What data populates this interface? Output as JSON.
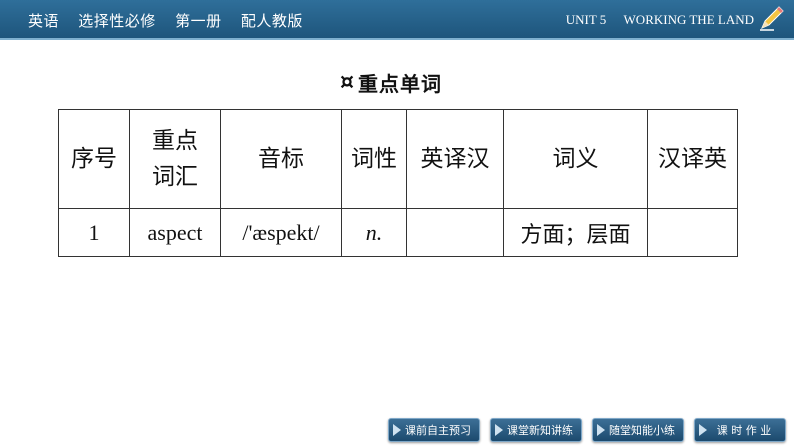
{
  "header": {
    "left": [
      "英语",
      "选择性必修",
      "第一册",
      "配人教版"
    ],
    "unit": "UNIT 5",
    "unit_title": "WORKING THE LAND"
  },
  "section": {
    "symbol": "¤",
    "title": "重点单词"
  },
  "table": {
    "headers": [
      "序号",
      "重点\n词汇",
      "音标",
      "词性",
      "英译汉",
      "词义",
      "汉译英"
    ],
    "rows": [
      [
        "1",
        "aspect",
        "/'æspekt/",
        "n.",
        "",
        "方面；层面",
        ""
      ]
    ]
  },
  "nav": [
    "课前自主预习",
    "课堂新知讲练",
    "随堂知能小练",
    "课 时 作 业"
  ],
  "colors": {
    "header_bg": "#2a6590",
    "nav_bg": "#2c5d82"
  },
  "icons": [
    "pencil-icon",
    "arrow-right-icon"
  ]
}
